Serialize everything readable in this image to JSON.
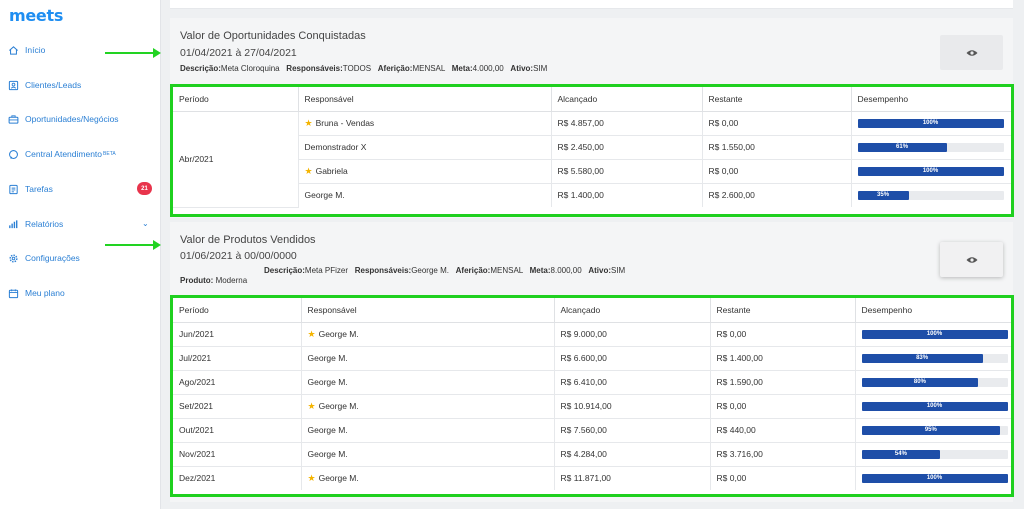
{
  "app": {
    "logo": "meets"
  },
  "sidebar": {
    "items": [
      {
        "label": "Início",
        "icon": "home-icon"
      },
      {
        "label": "Clientes/Leads",
        "icon": "contacts-icon"
      },
      {
        "label": "Oportunidades/Negócios",
        "icon": "briefcase-icon"
      },
      {
        "label": "Central Atendimento",
        "sup": "BETA",
        "icon": "chat-icon"
      },
      {
        "label": "Tarefas",
        "icon": "tasks-icon",
        "badge": "21"
      },
      {
        "label": "Relatórios",
        "icon": "chart-icon"
      },
      {
        "label": "Configurações",
        "icon": "gear-icon"
      },
      {
        "label": "Meu plano",
        "icon": "calendar-icon"
      }
    ]
  },
  "colors": {
    "accent": "#1f8ef1",
    "highlight": "#1fd01f",
    "bar": "#1e4ea8",
    "badge": "#e8344c"
  },
  "goal1": {
    "title": "Valor de Oportunidades Conquistadas",
    "date": "01/04/2021 à 27/04/2021",
    "desc_label": "Descrição:",
    "desc": "Meta Cloroquina",
    "resp_label": "Responsáveis:",
    "resp": "TODOS",
    "afer_label": "Aferição:",
    "afer": "MENSAL",
    "meta_label": "Meta:",
    "meta": "4.000,00",
    "ativo_label": "Ativo:",
    "ativo": "SIM",
    "headers": [
      "Período",
      "Responsável",
      "Alcançado",
      "Restante",
      "Desempenho"
    ],
    "period": "Abr/2021",
    "rows": [
      {
        "star": true,
        "resp": "Bruna - Vendas",
        "alc": "R$ 4.857,00",
        "rest": "R$ 0,00",
        "pct": 100,
        "pct_label": "100%"
      },
      {
        "star": false,
        "resp": "Demonstrador X",
        "alc": "R$ 2.450,00",
        "rest": "R$ 1.550,00",
        "pct": 61,
        "pct_label": "61%"
      },
      {
        "star": true,
        "resp": "Gabriela",
        "alc": "R$ 5.580,00",
        "rest": "R$ 0,00",
        "pct": 100,
        "pct_label": "100%"
      },
      {
        "star": false,
        "resp": "George M.",
        "alc": "R$ 1.400,00",
        "rest": "R$ 2.600,00",
        "pct": 35,
        "pct_label": "35%"
      }
    ]
  },
  "goal2": {
    "title": "Valor de Produtos Vendidos",
    "date": "01/06/2021 à 00/00/0000",
    "prod_label": "Produto:",
    "prod": "Moderna",
    "desc_label": "Descrição:",
    "desc": "Meta PFizer",
    "resp_label": "Responsáveis:",
    "resp": "George M.",
    "afer_label": "Aferição:",
    "afer": "MENSAL",
    "meta_label": "Meta:",
    "meta": "8.000,00",
    "ativo_label": "Ativo:",
    "ativo": "SIM",
    "headers": [
      "Período",
      "Responsável",
      "Alcançado",
      "Restante",
      "Desempenho"
    ],
    "rows": [
      {
        "period": "Jun/2021",
        "star": true,
        "resp": "George M.",
        "alc": "R$ 9.000,00",
        "rest": "R$ 0,00",
        "pct": 100,
        "pct_label": "100%"
      },
      {
        "period": "Jul/2021",
        "star": false,
        "resp": "George M.",
        "alc": "R$ 6.600,00",
        "rest": "R$ 1.400,00",
        "pct": 83,
        "pct_label": "83%"
      },
      {
        "period": "Ago/2021",
        "star": false,
        "resp": "George M.",
        "alc": "R$ 6.410,00",
        "rest": "R$ 1.590,00",
        "pct": 80,
        "pct_label": "80%"
      },
      {
        "period": "Set/2021",
        "star": true,
        "resp": "George M.",
        "alc": "R$ 10.914,00",
        "rest": "R$ 0,00",
        "pct": 100,
        "pct_label": "100%"
      },
      {
        "period": "Out/2021",
        "star": false,
        "resp": "George M.",
        "alc": "R$ 7.560,00",
        "rest": "R$ 440,00",
        "pct": 95,
        "pct_label": "95%"
      },
      {
        "period": "Nov/2021",
        "star": false,
        "resp": "George M.",
        "alc": "R$ 4.284,00",
        "rest": "R$ 3.716,00",
        "pct": 54,
        "pct_label": "54%"
      },
      {
        "period": "Dez/2021",
        "star": true,
        "resp": "George M.",
        "alc": "R$ 11.871,00",
        "rest": "R$ 0,00",
        "pct": 100,
        "pct_label": "100%"
      }
    ]
  }
}
